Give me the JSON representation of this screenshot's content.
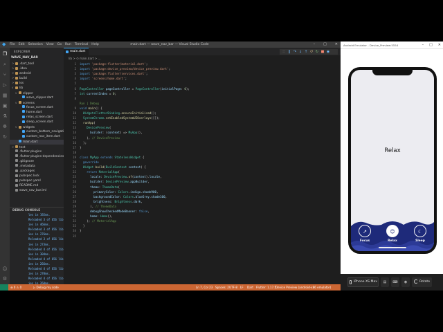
{
  "vscode": {
    "title": "main.dart — wave_nav_bar — Visual Studio Code",
    "menus": [
      "File",
      "Edit",
      "Selection",
      "View",
      "Go",
      "Run",
      "Terminal",
      "Help"
    ],
    "explorer_label": "EXPLORER",
    "project": "WAVE_NAV_BAR",
    "tree": [
      {
        "label": ".dart_tool",
        "twisty": ">",
        "depth": 1,
        "icon": "folder-icon"
      },
      {
        "label": ".idea",
        "twisty": ">",
        "depth": 1,
        "icon": "folder-icon"
      },
      {
        "label": "android",
        "twisty": ">",
        "depth": 1,
        "icon": "folder-icon"
      },
      {
        "label": "build",
        "twisty": ">",
        "depth": 1,
        "icon": "folder-icon"
      },
      {
        "label": "ios",
        "twisty": ">",
        "depth": 1,
        "icon": "folder-icon"
      },
      {
        "label": "lib",
        "twisty": "v",
        "depth": 1,
        "icon": "folder-icon"
      },
      {
        "label": "clipper",
        "twisty": "v",
        "depth": 2,
        "icon": "folder-icon"
      },
      {
        "label": "wave_clipper.dart",
        "twisty": "",
        "depth": 3,
        "icon": "dart-file-icon"
      },
      {
        "label": "screens",
        "twisty": "v",
        "depth": 2,
        "icon": "folder-icon"
      },
      {
        "label": "focus_screen.dart",
        "twisty": "",
        "depth": 3,
        "icon": "dart-file-icon"
      },
      {
        "label": "home.dart",
        "twisty": "",
        "depth": 3,
        "icon": "dart-file-icon"
      },
      {
        "label": "relax_screen.dart",
        "twisty": "",
        "depth": 3,
        "icon": "dart-file-icon"
      },
      {
        "label": "sleep_screen.dart",
        "twisty": "",
        "depth": 3,
        "icon": "dart-file-icon"
      },
      {
        "label": "widgets",
        "twisty": "v",
        "depth": 2,
        "icon": "folder-icon"
      },
      {
        "label": "custom_bottom_navigation_b...",
        "twisty": "",
        "depth": 3,
        "icon": "dart-file-icon"
      },
      {
        "label": "custom_nav_item.dart",
        "twisty": "",
        "depth": 3,
        "icon": "dart-file-icon"
      },
      {
        "label": "main.dart",
        "twisty": "",
        "depth": 2,
        "icon": "dart-file-icon",
        "selected": true
      },
      {
        "label": "test",
        "twisty": ">",
        "depth": 1,
        "icon": "folder-icon"
      },
      {
        "label": ".flutter-plugins",
        "twisty": "",
        "depth": 1,
        "icon": "file-icon"
      },
      {
        "label": ".flutter-plugins-dependencies",
        "twisty": "",
        "depth": 1,
        "icon": "file-icon"
      },
      {
        "label": ".gitignore",
        "twisty": "",
        "depth": 1,
        "icon": "file-icon"
      },
      {
        "label": ".metadata",
        "twisty": "",
        "depth": 1,
        "icon": "file-icon"
      },
      {
        "label": ".packages",
        "twisty": "",
        "depth": 1,
        "icon": "file-icon"
      },
      {
        "label": "pubspec.lock",
        "twisty": "",
        "depth": 1,
        "icon": "file-icon"
      },
      {
        "label": "pubspec.yaml",
        "twisty": "",
        "depth": 1,
        "icon": "file-icon"
      },
      {
        "label": "README.md",
        "twisty": "",
        "depth": 1,
        "icon": "file-icon"
      },
      {
        "label": "wave_nav_bar.iml",
        "twisty": "",
        "depth": 1,
        "icon": "file-icon"
      }
    ],
    "debug_console_label": "DEBUG CONSOLE",
    "console_lines": [
      "les in 192ms.",
      "Reloaded 3 of 656 librar",
      "ies in 466ms.",
      "Reloaded 3 of 656 librar",
      "ies in 276ms.",
      "Reloaded 3 of 656 librar",
      "ies in 273ms.",
      "Reloaded 4 of 656 librar",
      "ies in 304ms.",
      "Reloaded 4 of 656 librar",
      "ies in 266ms.",
      "Reloaded 4 of 656 librar",
      "ies in 270ms.",
      "Reloaded 4 of 656 librar",
      "ies in 260ms.",
      "Reloaded 4 of 656 librar",
      "ies in 193ms."
    ],
    "tab_label": "main.dart",
    "breadcrumb": "lib > ⊙ main.dart > ...",
    "code": [
      {
        "ln": "1",
        "html": "<span class=\"k\">import</span> <span class=\"s\">'package:flutter/material.dart'</span>;"
      },
      {
        "ln": "2",
        "html": "<span class=\"k\">import</span> <span class=\"s\">'package:device_preview/device_preview.dart'</span>;"
      },
      {
        "ln": "3",
        "html": "<span class=\"k\">import</span> <span class=\"s\">'package:flutter/services.dart'</span>;"
      },
      {
        "ln": "4",
        "html": "<span class=\"k\">import</span> <span class=\"s\">'screens/home.dart'</span>;"
      },
      {
        "ln": "5",
        "html": ""
      },
      {
        "ln": "6",
        "html": "<span class=\"t\">PageController</span> <span class=\"v\">pageController</span> = <span class=\"t\">PageController</span>(<span class=\"v\">initialPage</span>: <span class=\"n\">0</span>);"
      },
      {
        "ln": "7",
        "html": "<span class=\"t\">int</span> <span class=\"v\">currentIndex</span> = <span class=\"n\">0</span>;"
      },
      {
        "ln": "8",
        "html": ""
      },
      {
        "ln": "",
        "html": "<span class=\"c\">Run | Debug</span>"
      },
      {
        "ln": "9",
        "html": "<span class=\"k\">void</span> <span class=\"f\">main</span>() {"
      },
      {
        "ln": "10",
        "html": "  <span class=\"t\">WidgetsFlutterBinding</span>.<span class=\"f\">ensureInitialized</span>();"
      },
      {
        "ln": "11",
        "html": "  <span class=\"t\">SystemChrome</span>.<span class=\"f\">setEnabledSystemUIOverlays</span>([]);"
      },
      {
        "ln": "12",
        "html": "  <span class=\"f\">runApp</span>("
      },
      {
        "ln": "13",
        "html": "    <span class=\"t\">DevicePreview</span>("
      },
      {
        "ln": "14",
        "html": "      <span class=\"v\">builder</span>: (<span class=\"v\">context</span>) => <span class=\"t\">MyApp</span>(),"
      },
      {
        "ln": "15",
        "html": "    ), <span class=\"c\">// DevicePreview</span>"
      },
      {
        "ln": "16",
        "html": "  );"
      },
      {
        "ln": "17",
        "html": "}"
      },
      {
        "ln": "18",
        "html": ""
      },
      {
        "ln": "19",
        "html": "<span class=\"k\">class</span> <span class=\"t\">MyApp</span> <span class=\"k\">extends</span> <span class=\"t\">StatelessWidget</span> {"
      },
      {
        "ln": "20",
        "html": "  <span class=\"k\">@override</span>"
      },
      {
        "ln": "21",
        "html": "  <span class=\"t\">Widget</span> <span class=\"f\">build</span>(<span class=\"t\">BuildContext</span> <span class=\"v\">context</span>) {"
      },
      {
        "ln": "22",
        "html": "    <span class=\"k\">return</span> <span class=\"t\">MaterialApp</span>("
      },
      {
        "ln": "23",
        "html": "      <span class=\"v\">locale</span>: <span class=\"t\">DevicePreview</span>.<span class=\"f\">of</span>(<span class=\"v\">context</span>).<span class=\"v\">locale</span>,"
      },
      {
        "ln": "24",
        "html": "      <span class=\"v\">builder</span>: <span class=\"t\">DevicePreview</span>.<span class=\"v\">appBuilder</span>,"
      },
      {
        "ln": "25",
        "html": "      <span class=\"v\">theme</span>: <span class=\"t\">ThemeData</span>("
      },
      {
        "ln": "26",
        "html": "        <span class=\"v\">primaryColor</span>: <span class=\"t\">Colors</span>.<span class=\"v\">indigo</span>.<span class=\"v\">shade900</span>,"
      },
      {
        "ln": "27",
        "html": "        <span class=\"v\">backgroundColor</span>: <span class=\"t\">Colors</span>.<span class=\"v\">blueGrey</span>.<span class=\"v\">shade100</span>,"
      },
      {
        "ln": "28",
        "html": "        <span class=\"v\">brightness</span>: <span class=\"t\">Brightness</span>.<span class=\"v\">dark</span>,"
      },
      {
        "ln": "29",
        "html": "      ), <span class=\"c\">// ThemeData</span>"
      },
      {
        "ln": "30",
        "html": "      <span class=\"v\">debugShowCheckedModeBanner</span>: <span class=\"k\">false</span>,"
      },
      {
        "ln": "31",
        "html": "      <span class=\"v\">home</span>: <span class=\"t\">Home</span>(),"
      },
      {
        "ln": "32",
        "html": "    ); <span class=\"c\">// MaterialApp</span>"
      },
      {
        "ln": "33",
        "html": "  }"
      },
      {
        "ln": "34",
        "html": "}"
      },
      {
        "ln": "35",
        "html": ""
      }
    ],
    "status": {
      "branch": "⊗ 0 ⚠ 0",
      "debug": "▷ Debug my code",
      "position": "Ln 7, Col 23",
      "spaces": "Spaces: 2",
      "encoding": "UTF-8",
      "eol": "LF",
      "language": "Dart",
      "flutter": "Flutter: 1.17.5",
      "device": "Device Preview (android-x86 emulator)"
    },
    "accent_color": "#cc6633"
  },
  "emulator": {
    "title": "Android Emulator - Device_Preview:5554",
    "app": {
      "screen_text": "Relax",
      "nav_items": [
        {
          "label": "Focus",
          "icon": "focus-icon",
          "glyph": "↗"
        },
        {
          "label": "Relax",
          "icon": "relax-icon",
          "glyph": "☺"
        },
        {
          "label": "Sleep",
          "icon": "moon-icon",
          "glyph": "☾"
        }
      ],
      "selected": 1,
      "nav_color": "#1e2a7a"
    },
    "device_name": "iPhone XS Max",
    "rotate_label": "Rotate"
  }
}
